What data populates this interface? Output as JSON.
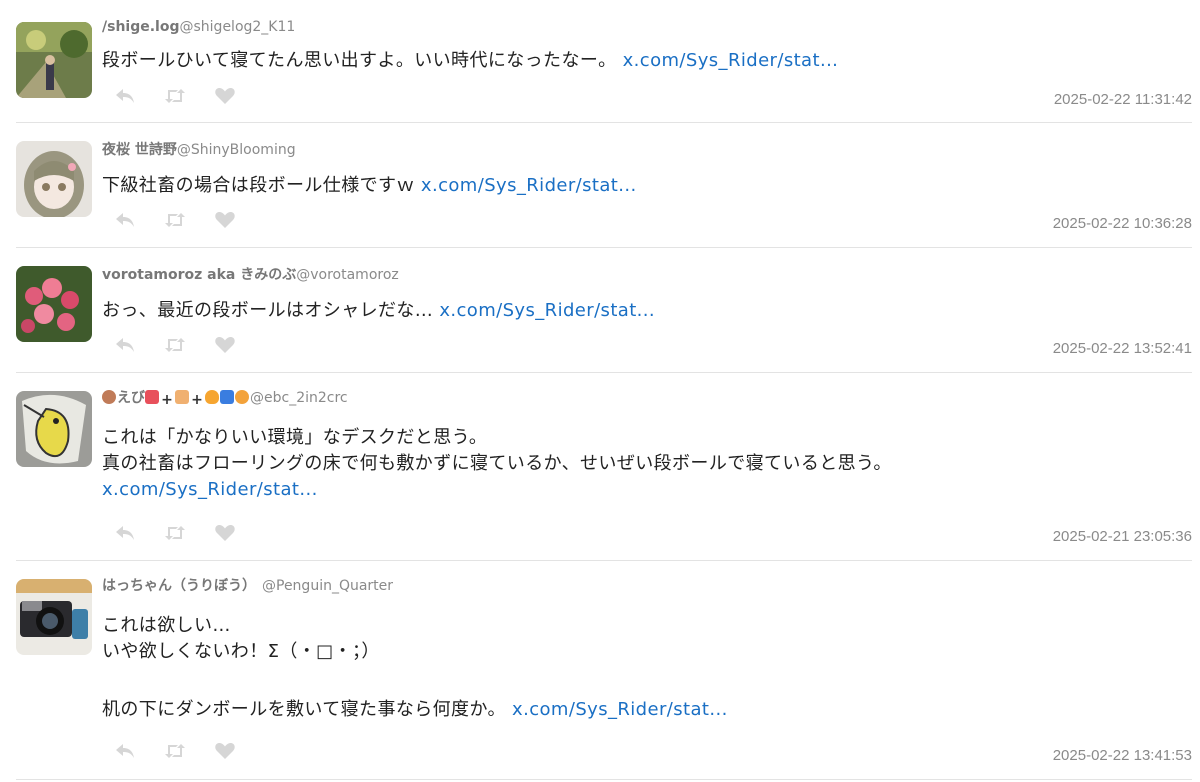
{
  "tweets": [
    {
      "name": "/shige.log",
      "handle": "@shigelog2_K11",
      "lines": [
        "段ボールひいて寝てたん思い出すよ。いい時代になったなー。 "
      ],
      "link": "x.com/Sys_Rider/stat...",
      "time": "2025-02-22 11:31:42"
    },
    {
      "name": "夜桜 世詩野",
      "handle": "@ShinyBlooming",
      "lines": [
        "下級社畜の場合は段ボール仕様ですｗ "
      ],
      "link": "x.com/Sys_Rider/stat...",
      "time": "2025-02-22 10:36:28"
    },
    {
      "name": "vorotamoroz aka きみのぶ",
      "handle": "@vorotamoroz",
      "lines": [
        "おっ、最近の段ボールはオシャレだな… "
      ],
      "link": "x.com/Sys_Rider/stat...",
      "time": "2025-02-22 13:52:41"
    },
    {
      "name": "えび",
      "handle": "@ebc_2in2crc",
      "lines": [
        "これは「かなりいい環境」なデスクだと思う。",
        "真の社畜はフローリングの床で何も敷かずに寝ているか、せいぜい段ボールで寝ていると思う。"
      ],
      "link": "x.com/Sys_Rider/stat...",
      "time": "2025-02-21 23:05:36"
    },
    {
      "name": "はっちゃん（うりぼう）",
      "handle": "@Penguin_Quarter",
      "lines": [
        "これは欲しい…",
        "いや欲しくないわ！Σ（・□・；）",
        "",
        "机の下にダンボールを敷いて寝た事なら何度か。 "
      ],
      "link": "x.com/Sys_Rider/stat...",
      "time": "2025-02-22 13:41:53"
    }
  ],
  "icons": {
    "reply": "reply-icon",
    "retweet": "retweet-icon",
    "like": "heart-icon"
  },
  "colors": {
    "link": "#1a6fc4",
    "meta": "#8a8a8a",
    "icon": "#d6d6d6"
  }
}
